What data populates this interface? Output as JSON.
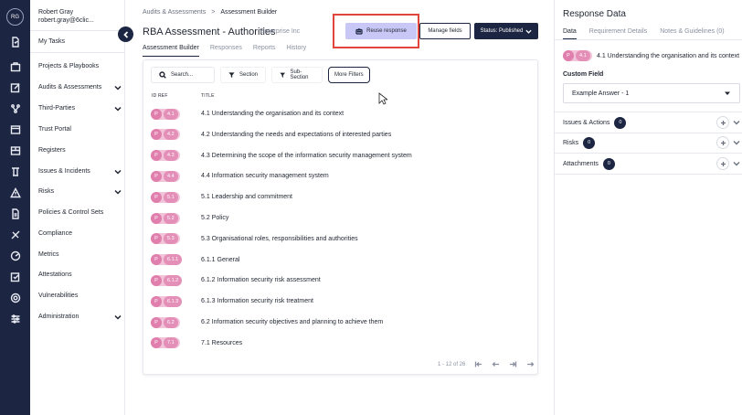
{
  "user": {
    "initials": "RG",
    "name": "Robert Gray",
    "email": "robert.gray@6clic..."
  },
  "nav": {
    "items": [
      {
        "label": "My Tasks",
        "chevron": false,
        "icon": "task-icon"
      },
      {
        "label": "Projects & Playbooks",
        "chevron": false,
        "icon": "briefcase-icon"
      },
      {
        "label": "Audits & Assessments",
        "chevron": true,
        "icon": "edit-icon"
      },
      {
        "label": "Third-Parties",
        "chevron": true,
        "icon": "network-icon"
      },
      {
        "label": "Trust Portal",
        "chevron": false,
        "icon": "portal-icon"
      },
      {
        "label": "Registers",
        "chevron": false,
        "icon": "register-icon"
      },
      {
        "label": "Issues & Incidents",
        "chevron": true,
        "icon": "issue-icon"
      },
      {
        "label": "Risks",
        "chevron": true,
        "icon": "warning-icon"
      },
      {
        "label": "Policies & Control Sets",
        "chevron": false,
        "icon": "policy-icon"
      },
      {
        "label": "Compliance",
        "chevron": false,
        "icon": "compliance-icon"
      },
      {
        "label": "Metrics",
        "chevron": false,
        "icon": "metrics-icon"
      },
      {
        "label": "Attestations",
        "chevron": false,
        "icon": "attestation-icon"
      },
      {
        "label": "Vulnerabilities",
        "chevron": false,
        "icon": "vulnerability-icon"
      },
      {
        "label": "Administration",
        "chevron": true,
        "icon": "sliders-icon"
      }
    ]
  },
  "breadcrumb": {
    "parent": "Audits & Assessments",
    "sep": ">",
    "current": "Assessment Builder"
  },
  "header": {
    "title": "RBA Assessment - Authorities",
    "subtitle": "Enterprise Inc",
    "reuse_label": "Reuse response",
    "manage_label": "Manage fields",
    "status_label": "Status: Published"
  },
  "tabs": [
    "Assessment Builder",
    "Responses",
    "Reports",
    "History"
  ],
  "filters": {
    "search_placeholder": "Search...",
    "section": "Section",
    "sub_section": "Sub-Section",
    "more": "More Filters"
  },
  "table": {
    "col_id": "ID REF",
    "col_title": "TITLE",
    "rows": [
      {
        "p": "P",
        "id": "4.1",
        "title": "4.1 Understanding the organisation and its context"
      },
      {
        "p": "P",
        "id": "4.2",
        "title": "4.2 Understanding the needs and expectations of interested parties"
      },
      {
        "p": "P",
        "id": "4.3",
        "title": "4.3 Determining the scope of the information security management system"
      },
      {
        "p": "P",
        "id": "4.4",
        "title": "4.4 Information security management system"
      },
      {
        "p": "P",
        "id": "5.1",
        "title": "5.1 Leadership and commitment"
      },
      {
        "p": "P",
        "id": "5.2",
        "title": "5.2 Policy"
      },
      {
        "p": "P",
        "id": "5.3",
        "title": "5.3 Organisational roles, responsibilities and authorities"
      },
      {
        "p": "P",
        "id": "6.1.1",
        "title": "6.1.1 General"
      },
      {
        "p": "P",
        "id": "6.1.2",
        "title": "6.1.2 Information security risk assessment"
      },
      {
        "p": "P",
        "id": "6.1.3",
        "title": "6.1.3 Information security risk treatment"
      },
      {
        "p": "P",
        "id": "6.2",
        "title": "6.2 Information security objectives and planning to achieve them"
      },
      {
        "p": "P",
        "id": "7.1",
        "title": "7.1 Resources"
      }
    ]
  },
  "pager": {
    "range": "1 - 12 of 26"
  },
  "panel": {
    "title": "Response Data",
    "tabs": [
      "Data",
      "Requirement Details",
      "Notes & Guidelines (0)"
    ],
    "req_p": "P",
    "req_id": "4.1",
    "req_title": "4.1 Understanding the organisation and its context",
    "custom_field_label": "Custom Field",
    "custom_field_value": "Example Answer - 1",
    "sections": [
      {
        "label": "Issues & Actions",
        "count": "0"
      },
      {
        "label": "Risks",
        "count": "0"
      },
      {
        "label": "Attachments",
        "count": "0"
      }
    ]
  },
  "colors": {
    "navy": "#1c2541",
    "pill": "#e07fad",
    "reuse": "#c9c7f5",
    "highlight": "#e2453c"
  }
}
